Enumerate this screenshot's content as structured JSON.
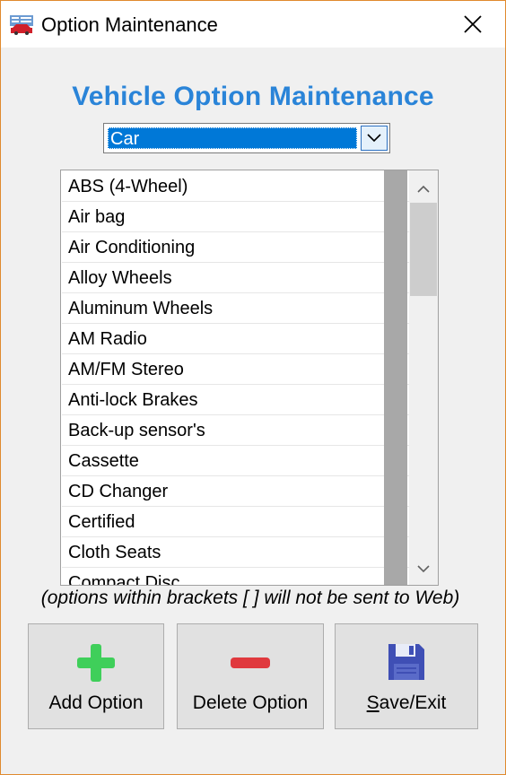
{
  "window": {
    "title": "Option Maintenance",
    "close_icon": "close-icon",
    "app_icon": "car-list-icon"
  },
  "heading": "Vehicle Option Maintenance",
  "vehicle_type": {
    "selected": "Car",
    "arrow_icon": "chevron-down-icon"
  },
  "options": [
    "ABS (4-Wheel)",
    "Air bag",
    "Air Conditioning",
    "Alloy Wheels",
    "Aluminum Wheels",
    "AM Radio",
    "AM/FM Stereo",
    "Anti-lock Brakes",
    "Back-up sensor's",
    "Cassette",
    "CD Changer",
    "Certified",
    "Cloth Seats",
    "Compact Disc"
  ],
  "note": "(options within brackets [ ] will not be sent to Web)",
  "buttons": {
    "add": {
      "label": "Add Option",
      "icon": "plus-icon",
      "color": "#3fcf5a"
    },
    "delete": {
      "label": "Delete Option",
      "icon": "minus-icon",
      "color": "#e0393e"
    },
    "save": {
      "label_first": "S",
      "label_rest": "ave/Exit",
      "icon": "floppy-disk-icon",
      "color": "#3f4fb5"
    }
  },
  "colors": {
    "heading": "#2a84d8",
    "selection": "#0078d7",
    "window_border": "#e08a2e"
  }
}
